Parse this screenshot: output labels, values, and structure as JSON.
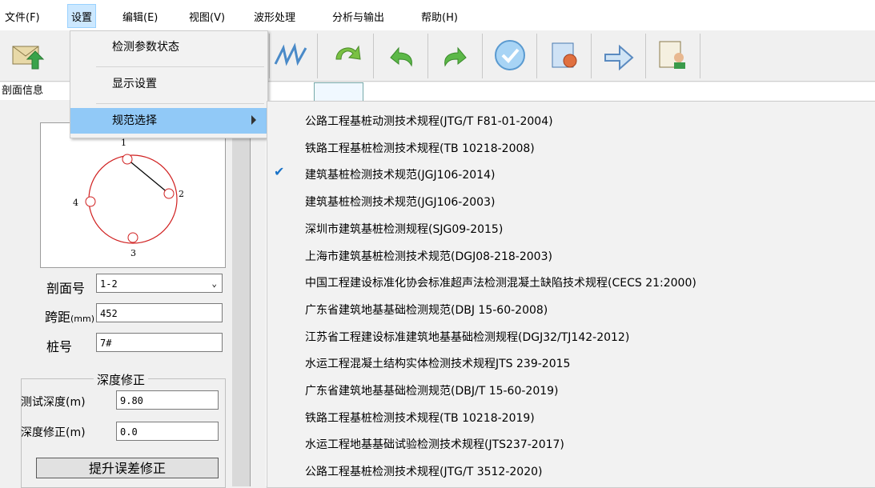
{
  "menubar": {
    "items": [
      "文件(F)",
      "设置",
      "编辑(E)",
      "视图(V)",
      "波形处理",
      "分析与输出",
      "帮助(H)"
    ]
  },
  "left_panel": {
    "title": "剖面信息",
    "pile_points": [
      "1",
      "2",
      "3",
      "4"
    ],
    "section_no_label": "剖面号",
    "section_no_value": "1-2",
    "span_label": "跨距",
    "span_unit": "(mm)",
    "span_value": "452",
    "pile_no_label": "桩号",
    "pile_no_value": "7#",
    "depth_group_title": "深度修正",
    "test_depth_label": "测试深度(m)",
    "test_depth_value": "9.80",
    "depth_correction_label": "深度修正(m)",
    "depth_correction_value": "0.0",
    "lift_error_button": "提升误差修正"
  },
  "settings_menu": {
    "items": [
      "检测参数状态",
      "显示设置",
      "规范选择"
    ]
  },
  "standards_menu": {
    "selected_index": 2,
    "items": [
      "公路工程基桩动测技术规程(JTG/T F81-01-2004)",
      "铁路工程基桩检测技术规程(TB 10218-2008)",
      "建筑基桩检测技术规范(JGJ106-2014)",
      "建筑基桩检测技术规范(JGJ106-2003)",
      "深圳市建筑基桩检测规程(SJG09-2015)",
      "上海市建筑基桩检测技术规范(DGJ08-218-2003)",
      "中国工程建设标准化协会标准超声法检测混凝土缺陷技术规程(CECS 21:2000)",
      "广东省建筑地基基础检测规范(DBJ 15-60-2008)",
      "江苏省工程建设标准建筑地基基础检测规程(DGJ32/TJ142-2012)",
      "水运工程混凝土结构实体检测技术规程JTS 239-2015",
      "广东省建筑地基基础检测规范(DBJ/T 15-60-2019)",
      "铁路工程基桩检测技术规程(TB 10218-2019)",
      "水运工程地基基础试验检测技术规程(JTS237-2017)",
      "公路工程基桩检测技术规程(JTG/T 3512-2020)"
    ]
  },
  "toolbar": {
    "icons": [
      "open-file-icon",
      "waveform-icon",
      "refresh-arrows-icon",
      "undo-icon",
      "redo-icon",
      "check-circle-icon",
      "analyze-icon",
      "forward-arrow-icon",
      "report-user-icon"
    ]
  },
  "colors": {
    "highlight": "#91c9f7",
    "menu_bg": "#f2f2f2",
    "check": "#1a73c8"
  }
}
